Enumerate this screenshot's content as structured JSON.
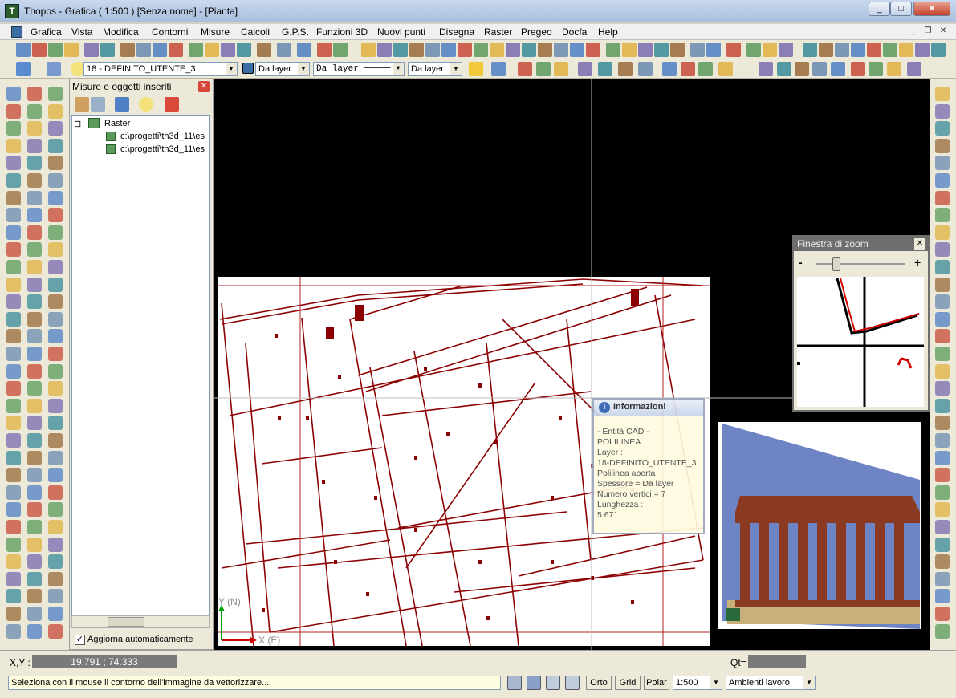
{
  "window": {
    "title": "Thopos - Grafica ( 1:500 ) [Senza nome] - [Pianta]",
    "app_icon": "thopos-logo-icon"
  },
  "menu": {
    "items": [
      "Grafica",
      "Vista",
      "Modifica",
      "Contorni",
      "Misure",
      "Calcoli",
      "G.P.S.",
      "Funzioni 3D",
      "Nuovi punti",
      "Disegna",
      "Raster",
      "Pregeo",
      "Docfa",
      "Help"
    ]
  },
  "toolbar2": {
    "layer_select": "18 - DEFINITO_UTENTE_3",
    "color_select": "Da layer",
    "linetype_select": "Da layer",
    "lineweight_select": "Da layer"
  },
  "panel": {
    "title": "Misure e oggetti inseriti",
    "tree_root": "Raster",
    "tree_items": [
      "c:\\progetti\\th3d_11\\es",
      "c:\\progetti\\th3d_11\\es"
    ],
    "auto_update_label": "Aggiorna automaticamente",
    "auto_update_checked": true
  },
  "canvas": {
    "axis_y_label": "Y (N)",
    "axis_x_label": "X (E)"
  },
  "zoom_window": {
    "title": "Finestra di zoom",
    "minus": "-",
    "plus": "+",
    "slider_level": 0.2
  },
  "info_window": {
    "title": "Informazioni",
    "lines": [
      "- Entità CAD -",
      "POLILINEA",
      "Layer :",
      "  18-DEFINITO_UTENTE_3",
      "Polilinea aperta",
      "Spessore = Da layer",
      "Numero vertici = 7",
      "Lunghezza :",
      "5.671"
    ]
  },
  "status": {
    "xy_label": "X,Y :",
    "xy_value": "19.791 ; 74.333",
    "qt_label": "Qt=",
    "qt_value": "",
    "message": "Seleziona con il mouse il contorno dell'immagine da vettorizzare...",
    "btn_orto": "Orto",
    "btn_grid": "Grid",
    "btn_polar": "Polar",
    "scale": "1:500",
    "workspace": "Ambienti lavoro"
  },
  "colors": {
    "accent": "#8b0000",
    "canvas_bg": "#000000",
    "info_bg": "#fffbe0"
  }
}
